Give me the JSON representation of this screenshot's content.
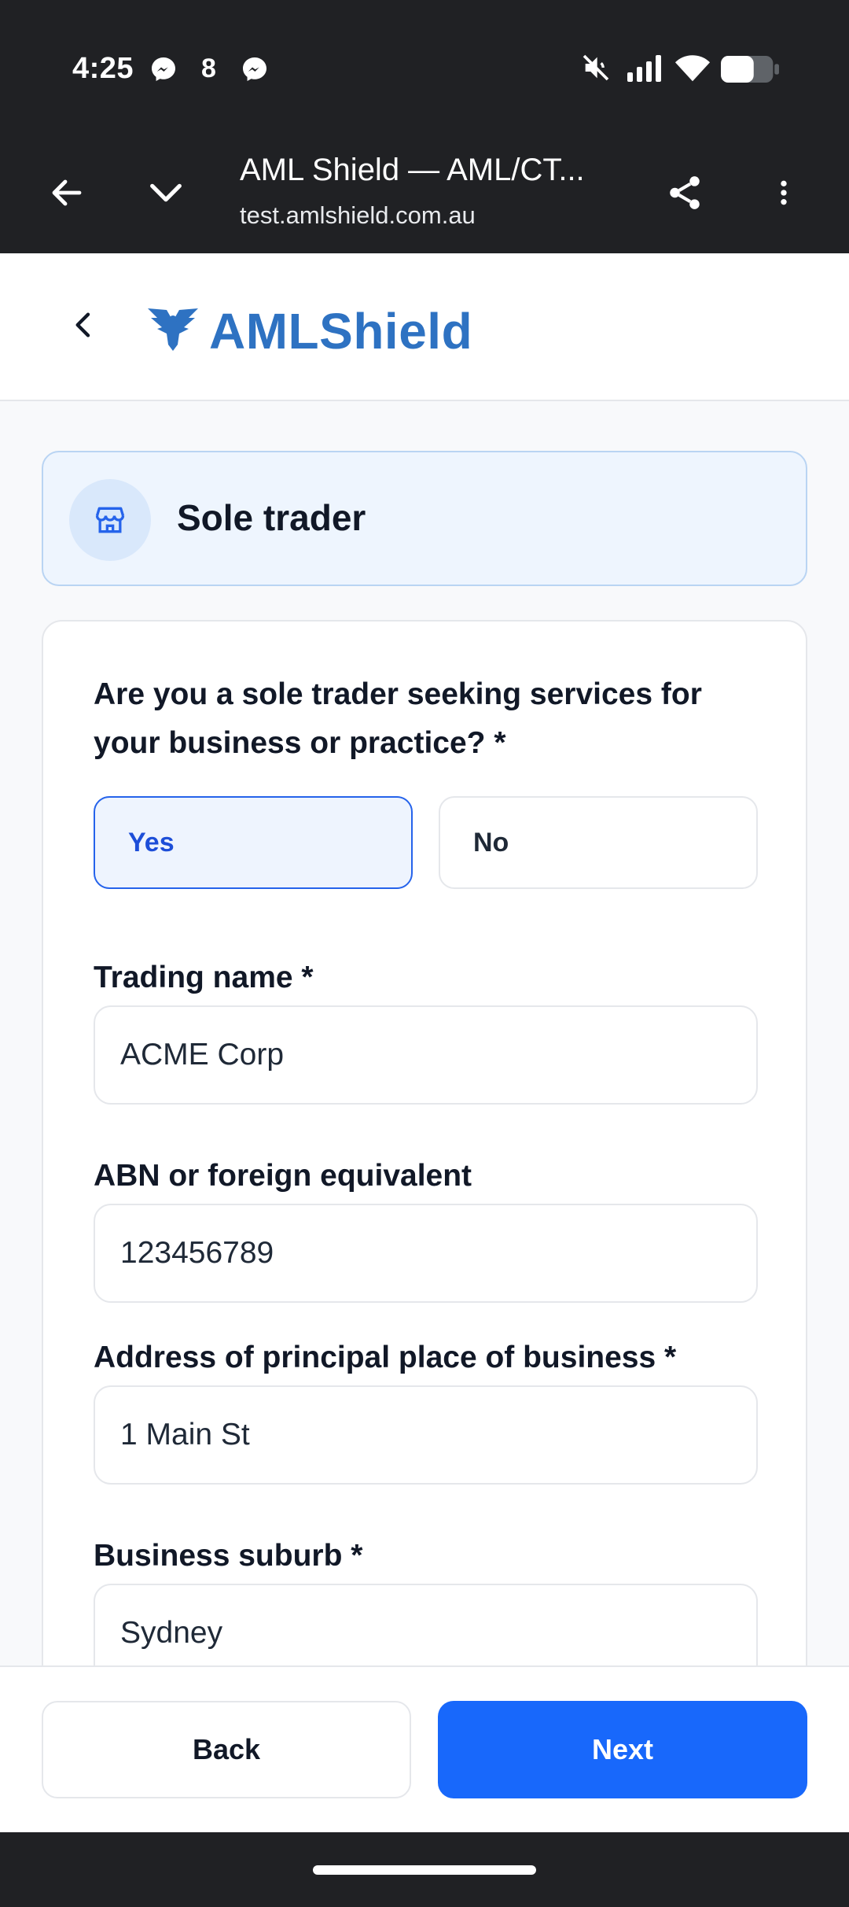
{
  "status_bar": {
    "time": "4:25",
    "notification_icons": [
      "messenger-icon",
      "number-badge-icon",
      "messenger-icon"
    ],
    "notification_count": "8",
    "right_icons": [
      "mute-icon",
      "signal-icon",
      "wifi-icon",
      "battery-icon"
    ]
  },
  "browser": {
    "title": "AML Shield — AML/CT...",
    "url": "test.amlshield.com.au",
    "icons": [
      "back-arrow-icon",
      "chevron-down-icon",
      "share-icon",
      "more-vert-icon"
    ]
  },
  "header": {
    "logo_part1": "AML",
    "logo_part2": "Shield",
    "brand_color": "#2e72c2"
  },
  "entity_type": {
    "title": "Sole trader",
    "icon": "storefront-icon"
  },
  "form": {
    "question": "Are you a sole trader seeking services for your business or practice? *",
    "options": [
      {
        "label": "Yes",
        "selected": true
      },
      {
        "label": "No",
        "selected": false
      }
    ],
    "fields": [
      {
        "label": "Trading name *",
        "value": "ACME Corp"
      },
      {
        "label": "ABN or foreign equivalent",
        "value": "123456789"
      },
      {
        "label": "Address of principal place of business *",
        "value": "1 Main St"
      },
      {
        "label": "Business suburb *",
        "value": "Sydney"
      }
    ]
  },
  "actions": {
    "back_label": "Back",
    "next_label": "Next",
    "primary_color": "#1868fb"
  }
}
